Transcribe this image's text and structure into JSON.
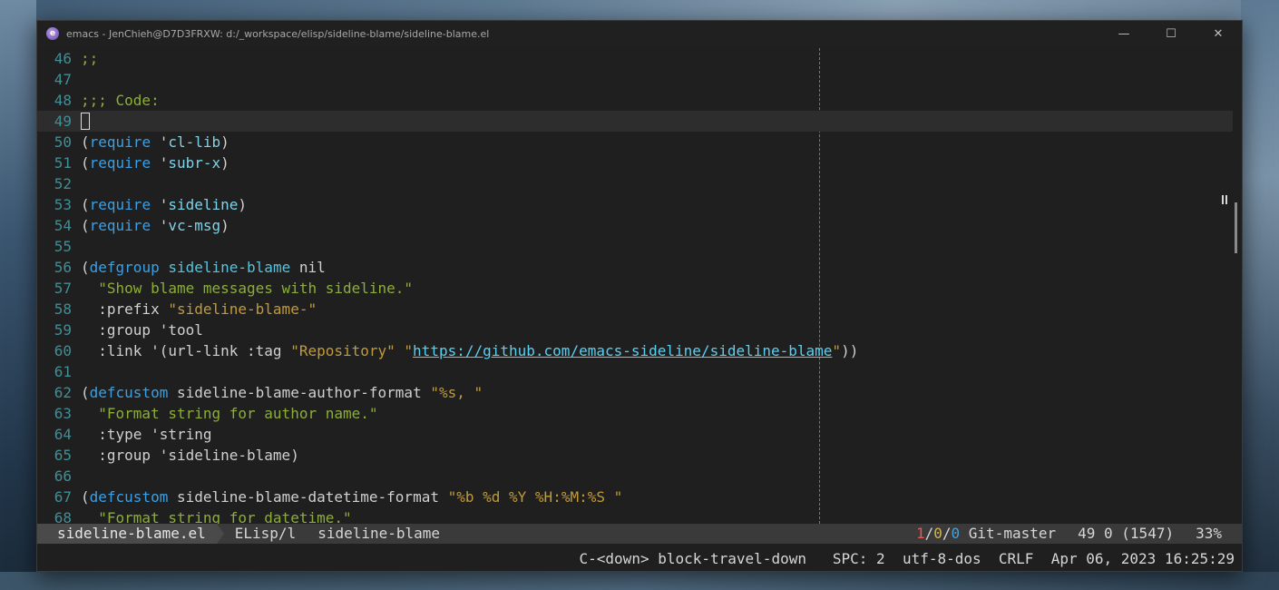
{
  "window": {
    "title": "emacs - JenChieh@D7D3FRXW: d:/_workspace/elisp/sideline-blame/sideline-blame.el",
    "app_icon_letter": "e",
    "controls": {
      "minimize": "—",
      "maximize": "☐",
      "close": "✕"
    }
  },
  "editor": {
    "lines": [
      {
        "num": "46",
        "tokens": [
          {
            "t": ";;",
            "c": "cm"
          }
        ]
      },
      {
        "num": "47",
        "tokens": []
      },
      {
        "num": "48",
        "tokens": [
          {
            "t": ";;; Code:",
            "c": "cm"
          }
        ]
      },
      {
        "num": "49",
        "tokens": [],
        "current": true
      },
      {
        "num": "50",
        "tokens": [
          {
            "t": "(",
            "c": "plain"
          },
          {
            "t": "require",
            "c": "kw"
          },
          {
            "t": " '",
            "c": "plain"
          },
          {
            "t": "cl-lib",
            "c": "sym"
          },
          {
            "t": ")",
            "c": "plain"
          }
        ]
      },
      {
        "num": "51",
        "tokens": [
          {
            "t": "(",
            "c": "plain"
          },
          {
            "t": "require",
            "c": "kw"
          },
          {
            "t": " '",
            "c": "plain"
          },
          {
            "t": "subr-x",
            "c": "sym"
          },
          {
            "t": ")",
            "c": "plain"
          }
        ]
      },
      {
        "num": "52",
        "tokens": []
      },
      {
        "num": "53",
        "tokens": [
          {
            "t": "(",
            "c": "plain"
          },
          {
            "t": "require",
            "c": "kw"
          },
          {
            "t": " '",
            "c": "plain"
          },
          {
            "t": "sideline",
            "c": "sym"
          },
          {
            "t": ")",
            "c": "plain"
          }
        ]
      },
      {
        "num": "54",
        "tokens": [
          {
            "t": "(",
            "c": "plain"
          },
          {
            "t": "require",
            "c": "kw"
          },
          {
            "t": " '",
            "c": "plain"
          },
          {
            "t": "vc-msg",
            "c": "sym"
          },
          {
            "t": ")",
            "c": "plain"
          }
        ]
      },
      {
        "num": "55",
        "tokens": []
      },
      {
        "num": "56",
        "tokens": [
          {
            "t": "(",
            "c": "plain"
          },
          {
            "t": "defgroup",
            "c": "kw"
          },
          {
            "t": " ",
            "c": "plain"
          },
          {
            "t": "sideline-blame",
            "c": "fn"
          },
          {
            "t": " nil",
            "c": "plain"
          }
        ]
      },
      {
        "num": "57",
        "tokens": [
          {
            "t": "  \"Show blame messages with sideline.\"",
            "c": "doc"
          }
        ]
      },
      {
        "num": "58",
        "tokens": [
          {
            "t": "  :prefix ",
            "c": "plain"
          },
          {
            "t": "\"sideline-blame-\"",
            "c": "str"
          }
        ]
      },
      {
        "num": "59",
        "tokens": [
          {
            "t": "  :group 'tool",
            "c": "plain"
          }
        ]
      },
      {
        "num": "60",
        "tokens": [
          {
            "t": "  :link '(url-link :tag ",
            "c": "plain"
          },
          {
            "t": "\"Repository\"",
            "c": "str"
          },
          {
            "t": " \"",
            "c": "str"
          },
          {
            "t": "https://github.com/emacs-sideline/sideline-blame",
            "c": "lnk"
          },
          {
            "t": "\"",
            "c": "str"
          },
          {
            "t": "))",
            "c": "plain"
          }
        ]
      },
      {
        "num": "61",
        "tokens": []
      },
      {
        "num": "62",
        "tokens": [
          {
            "t": "(",
            "c": "plain"
          },
          {
            "t": "defcustom",
            "c": "kw"
          },
          {
            "t": " sideline-blame-author-format ",
            "c": "plain"
          },
          {
            "t": "\"%s, \"",
            "c": "str"
          }
        ]
      },
      {
        "num": "63",
        "tokens": [
          {
            "t": "  \"Format string for author name.\"",
            "c": "doc"
          }
        ]
      },
      {
        "num": "64",
        "tokens": [
          {
            "t": "  :type 'string",
            "c": "plain"
          }
        ]
      },
      {
        "num": "65",
        "tokens": [
          {
            "t": "  :group 'sideline-blame)",
            "c": "plain"
          }
        ]
      },
      {
        "num": "66",
        "tokens": []
      },
      {
        "num": "67",
        "tokens": [
          {
            "t": "(",
            "c": "plain"
          },
          {
            "t": "defcustom",
            "c": "kw"
          },
          {
            "t": " sideline-blame-datetime-format ",
            "c": "plain"
          },
          {
            "t": "\"%b %d %Y %H:%M:%S \"",
            "c": "str"
          }
        ]
      },
      {
        "num": "68",
        "tokens": [
          {
            "t": "  \"Format string for datetime.\"",
            "c": "doc"
          }
        ]
      }
    ]
  },
  "modeline": {
    "buffer_name": "sideline-blame.el",
    "major_mode": "ELisp/l",
    "project": "sideline-blame",
    "git_r": "1",
    "git_y": "0",
    "git_b": "0",
    "git_branch": " Git-master",
    "position": "49 0 (1547)",
    "percent": "33%"
  },
  "echo_area": {
    "keybinding": "C-<down> block-travel-down",
    "indent": "SPC: 2",
    "encoding": "utf-8-dos",
    "eol": "CRLF",
    "datetime": "Apr 06, 2023 16:25:29"
  },
  "colors": {
    "background": "#1f1f1f",
    "line_number": "#3f8f97",
    "keyword": "#3aa0e6",
    "comment": "#8cae38",
    "string": "#c09a3c",
    "fill_column": "#c0555e"
  }
}
